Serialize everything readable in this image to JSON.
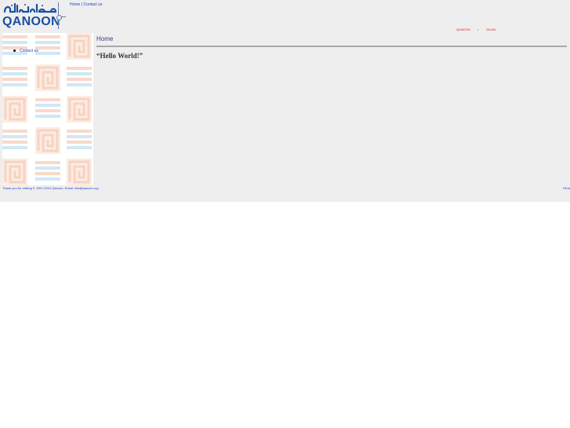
{
  "header": {
    "logo_arabic": "القانون",
    "logo_latin": "QANOON"
  },
  "topnav": {
    "home": "Home",
    "separator": "|",
    "contact": "Contact us"
  },
  "rightnav": {
    "item1": "QANOON",
    "dot": "•",
    "item2": "ISLAM"
  },
  "sidebar": {
    "items": [
      {
        "label": "Contact us"
      }
    ]
  },
  "main": {
    "title": "Home",
    "body": "“Hello World!”"
  },
  "footer": {
    "left": "Thank you for visiting © 1997-2010 Qanoon. Email: info@qanoon.org",
    "right": "Hit:st"
  },
  "colors": {
    "background": "#eeeeee",
    "link": "#1f3fcf",
    "accent_red": "#e02020",
    "logo_blue": "#1a4fa0",
    "title": "#3a3a8a"
  }
}
